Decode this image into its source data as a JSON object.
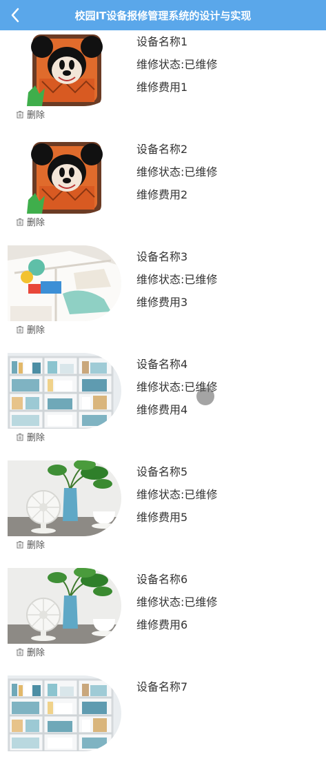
{
  "header": {
    "title": "校园IT设备报修管理系统的设计与实现",
    "background": "#5aa7ea",
    "back_icon": "chevron-left-icon"
  },
  "items": [
    {
      "name": "设备名称1",
      "status": "维修状态:已维修",
      "fee": "维修费用1",
      "delete_label": "删除",
      "image": "backpack"
    },
    {
      "name": "设备名称2",
      "status": "维修状态:已维修",
      "fee": "维修费用2",
      "delete_label": "删除",
      "image": "backpack"
    },
    {
      "name": "设备名称3",
      "status": "维修状态:已维修",
      "fee": "维修费用3",
      "delete_label": "删除",
      "image": "drawer"
    },
    {
      "name": "设备名称4",
      "status": "维修状态:已维修",
      "fee": "维修费用4",
      "delete_label": "删除",
      "image": "bookshelf"
    },
    {
      "name": "设备名称5",
      "status": "维修状态:已维修",
      "fee": "维修费用5",
      "delete_label": "删除",
      "image": "fan"
    },
    {
      "name": "设备名称6",
      "status": "维修状态:已维修",
      "fee": "维修费用6",
      "delete_label": "删除",
      "image": "fan"
    },
    {
      "name": "设备名称7",
      "status": "",
      "fee": "",
      "delete_label": "",
      "image": "bookshelf"
    }
  ],
  "icons": {
    "delete": "trash-icon"
  }
}
